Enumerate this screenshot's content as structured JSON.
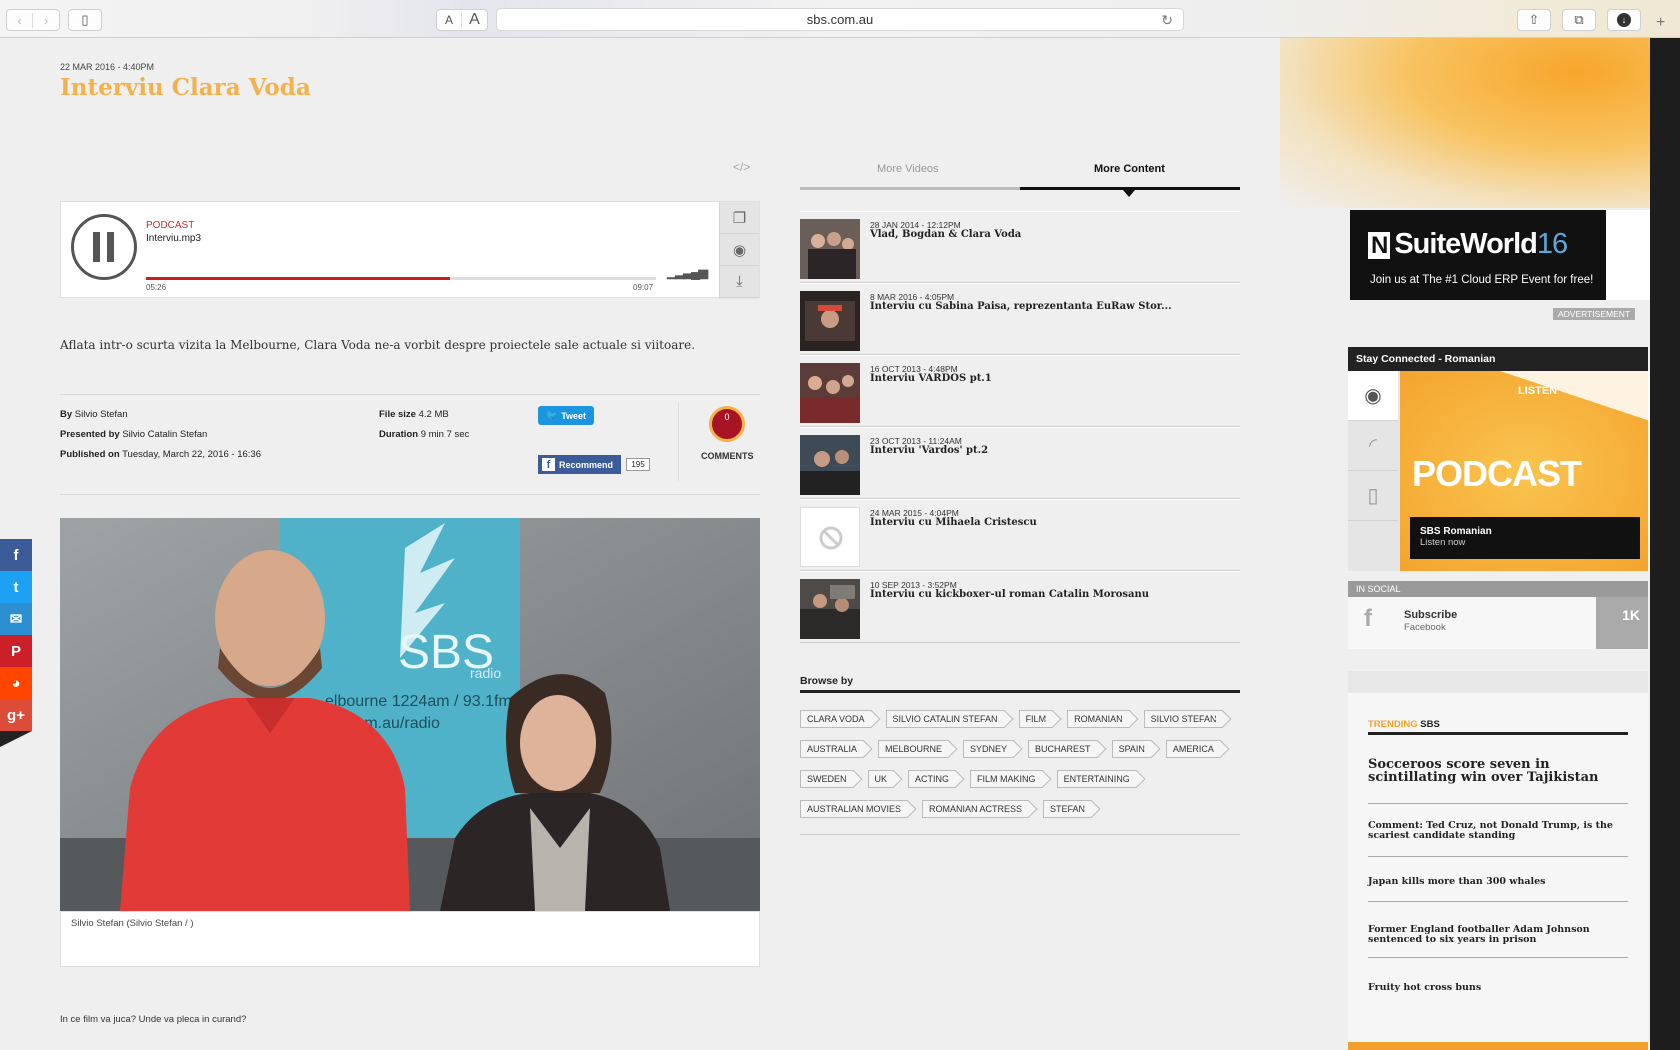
{
  "browser": {
    "url": "sbs.com.au",
    "font_small": "A",
    "font_large": "A"
  },
  "article": {
    "date": "22 MAR 2016 - 4:40PM",
    "title": "Interviu Clara Voda",
    "description": "Aflata intr-o scurta vizita la Melbourne, Clara Voda ne-a vorbit despre proiectele sale actuale si viitoare.",
    "by_label": "By",
    "by": "Silvio Stefan",
    "presented_label": "Presented by",
    "presented": "Silvio Catalin Stefan",
    "published_label": "Published on",
    "published": "Tuesday, March 22, 2016 - 16:36",
    "filesize_label": "File size",
    "filesize": "4.2 MB",
    "duration_label": "Duration",
    "duration": "9 min 7 sec",
    "caption": "Silvio Stefan (Silvio Stefan / )",
    "bottom_text": "In ce film va juca? Unde va pleca in curand?"
  },
  "player": {
    "label": "PODCAST",
    "file": "Interviu.mp3",
    "current": "05:26",
    "total": "09:07",
    "progress": 0.596,
    "embed": "</>"
  },
  "share": {
    "tweet": "Tweet",
    "recommend": "Recommend",
    "recommend_count": "195",
    "comments_count": "0",
    "comments_label": "COMMENTS"
  },
  "photo": {
    "sign_text": "SBS",
    "sign_sub": "radio",
    "sign_line1": "elbourne 1224am / 93.1fm",
    "sign_line2": "s.com.au/radio"
  },
  "tabs": {
    "videos": "More Videos",
    "content": "More Content"
  },
  "more_content": [
    {
      "date": "28 JAN 2014 - 12:12PM",
      "title": "Vlad, Bogdan & Clara Voda"
    },
    {
      "date": "8 MAR 2016 - 4:05PM",
      "title": "Interviu cu Sabina Paisa, reprezentanta EuRaw Stor..."
    },
    {
      "date": "16 OCT 2013 - 4:48PM",
      "title": "Interviu VARDOS pt.1"
    },
    {
      "date": "23 OCT 2013 - 11:24AM",
      "title": "Interviu 'Vardos' pt.2"
    },
    {
      "date": "24 MAR 2015 - 4:04PM",
      "title": "Interviu cu Mihaela Cristescu"
    },
    {
      "date": "10 SEP 2013 - 3:52PM",
      "title": "Interviu cu kickboxer-ul roman Catalin Morosanu"
    }
  ],
  "browse": {
    "heading": "Browse by",
    "tags": [
      "CLARA VODA",
      "SILVIO CATALIN STEFAN",
      "FILM",
      "ROMANIAN",
      "SILVIO STEFAN",
      "AUSTRALIA",
      "MELBOURNE",
      "SYDNEY",
      "BUCHAREST",
      "SPAIN",
      "AMERICA",
      "SWEDEN",
      "UK",
      "ACTING",
      "FILM MAKING",
      "ENTERTAINING",
      "AUSTRALIAN MOVIES",
      "ROMANIAN ACTRESS",
      "STEFAN"
    ]
  },
  "ad": {
    "logo": "N",
    "title": "SuiteWorld",
    "title_num": "16",
    "sub": "Join us at The #1 Cloud ERP Event for free!",
    "label": "ADVERTISEMENT"
  },
  "sidebar": {
    "stay": "Stay Connected - Romanian",
    "listen": "LISTEN",
    "podcast": "PODCAST",
    "station": "SBS Romanian",
    "listen_now": "Listen now",
    "in_social": "IN SOCIAL",
    "subscribe": "Subscribe",
    "facebook": "Facebook",
    "fb_count": "1K"
  },
  "trending": {
    "label_a": "TRENDING",
    "label_b": "SBS",
    "items": [
      "Socceroos score seven in scintillating win over Tajikistan",
      "Comment: Ted Cruz, not Donald Trump, is the scariest candidate standing",
      "Japan kills more than 300 whales",
      "Former England footballer Adam Johnson sentenced to six years in prison",
      "Fruity hot cross buns"
    ]
  },
  "colors": {
    "accent": "#f3b24b",
    "brand_orange": "#f2a02d",
    "progress": "#c81f1f"
  }
}
